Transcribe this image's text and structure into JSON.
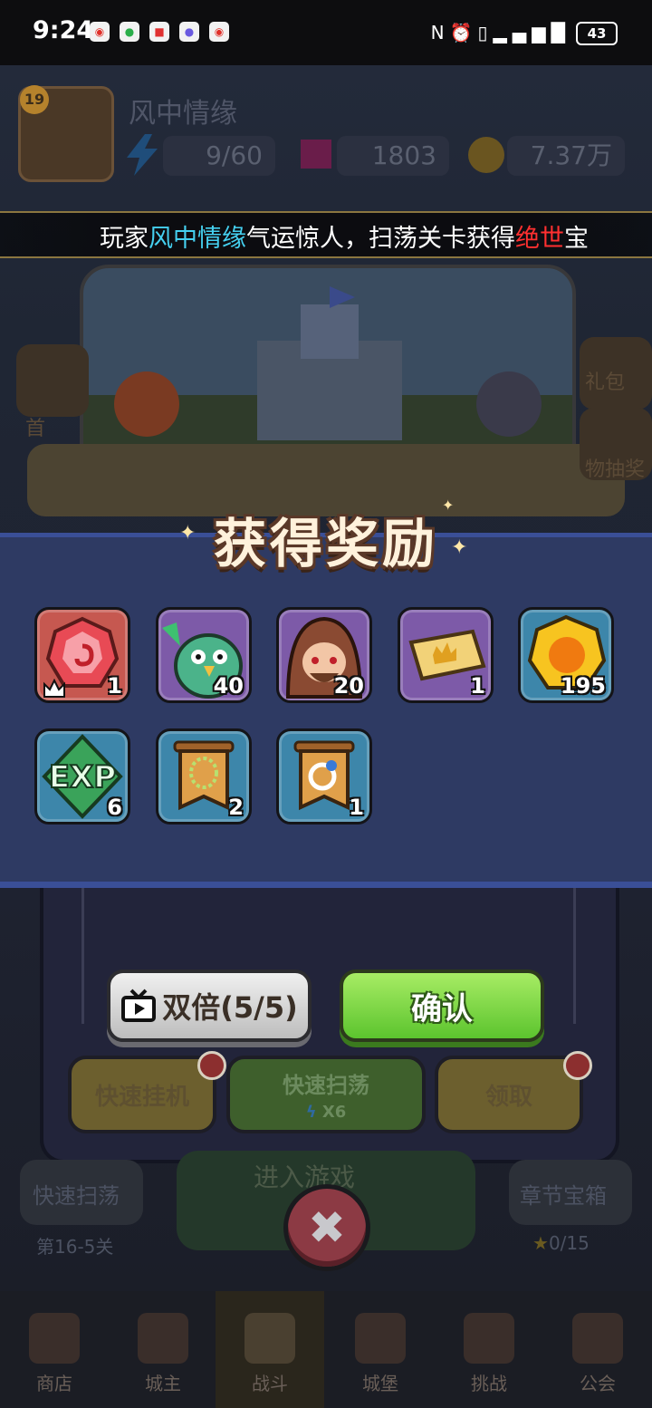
{
  "status_bar": {
    "time": "9:24",
    "battery": "43",
    "notification_icons": [
      "weibo-icon",
      "wechat-icon",
      "news-icon",
      "app-icon",
      "weibo-icon"
    ]
  },
  "background": {
    "level": "19",
    "player_name": "风中情缘",
    "stamina": "9/60",
    "gems": "1803",
    "coins": "7.37万",
    "side_labels": {
      "first_charge": "首",
      "gift_pack": "礼包",
      "draw": "物抽奖"
    },
    "bottom_labels": {
      "quick_sweep": "快速扫荡",
      "stage": "第16-5关",
      "enter_game": "进入游戏",
      "chapter_chest": "章节宝箱",
      "chest_progress": "0/15"
    }
  },
  "ticker": {
    "prefix": "玩家",
    "name": "风中情缘",
    "middle": "气运惊人，扫荡关卡获得",
    "rare": "绝世",
    "suffix": "宝"
  },
  "reward": {
    "title": "获得奖励",
    "items": [
      {
        "icon": "red-gem-icon",
        "count": "1",
        "bg": "red"
      },
      {
        "icon": "green-dragon-hero-icon",
        "count": "40",
        "bg": "purple"
      },
      {
        "icon": "hooded-hero-icon",
        "count": "20",
        "bg": "purple"
      },
      {
        "icon": "crown-ticket-icon",
        "count": "1",
        "bg": "purple"
      },
      {
        "icon": "gold-coin-icon",
        "count": "195",
        "bg": "blue"
      },
      {
        "icon": "exp-icon",
        "count": "6",
        "bg": "blue"
      },
      {
        "icon": "necklace-scroll-icon",
        "count": "2",
        "bg": "blue"
      },
      {
        "icon": "ring-scroll-icon",
        "count": "1",
        "bg": "blue"
      }
    ]
  },
  "dialog": {
    "double_label": "双倍(5/5)",
    "confirm_label": "确认",
    "quick_idle": "快速挂机",
    "quick_sweep": "快速扫荡",
    "sweep_cost": "X6",
    "claim": "领取"
  },
  "nav": {
    "shop": "商店",
    "lord": "城主",
    "battle": "战斗",
    "castle": "城堡",
    "challenge": "挑战",
    "guild": "公会"
  },
  "colors": {
    "panel": "#2e3a63",
    "panel_border": "#3a4f97",
    "confirm": "#6fd23a",
    "name_highlight": "#45d0f0",
    "rare_highlight": "#ff3030"
  }
}
